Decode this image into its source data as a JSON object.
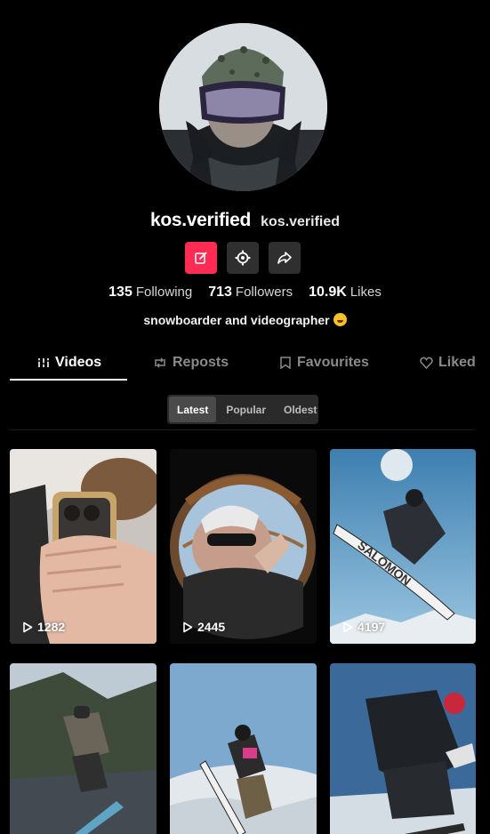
{
  "profile": {
    "username": "kos.verified",
    "nickname": "kos.verified",
    "bio": "snowboarder and videographer",
    "bio_emoji": "grimacing-face-emoji"
  },
  "actions": {
    "edit": "edit-icon",
    "settings": "settings-icon",
    "share": "share-icon",
    "edit_color": "#fe2c55"
  },
  "stats": [
    {
      "value": "135",
      "label": "Following"
    },
    {
      "value": "713",
      "label": "Followers"
    },
    {
      "value": "10.9K",
      "label": "Likes"
    }
  ],
  "tabs": [
    {
      "label": "Videos",
      "icon": "grid-bars-icon",
      "active": true
    },
    {
      "label": "Reposts",
      "icon": "repost-icon",
      "active": false
    },
    {
      "label": "Favourites",
      "icon": "bookmark-icon",
      "active": false
    },
    {
      "label": "Liked",
      "icon": "heart-icon",
      "active": false
    }
  ],
  "sort": {
    "options": [
      "Latest",
      "Popular",
      "Oldest"
    ],
    "selected": "Latest"
  },
  "videos": [
    {
      "views": "1282"
    },
    {
      "views": "2445"
    },
    {
      "views": "4197"
    },
    {
      "views": ""
    },
    {
      "views": ""
    },
    {
      "views": ""
    }
  ]
}
